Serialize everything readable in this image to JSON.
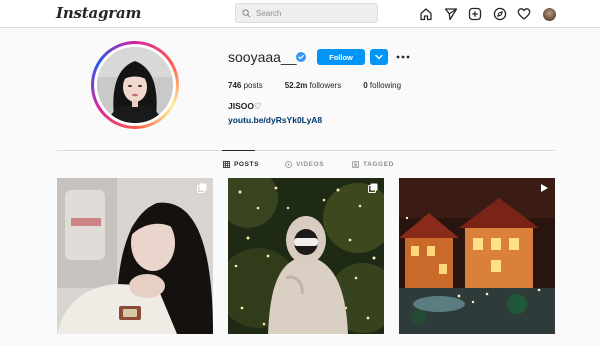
{
  "app": {
    "logo": "Instagram"
  },
  "search": {
    "placeholder": "Search"
  },
  "nav": {
    "icons": [
      "home-icon",
      "direct-message-icon",
      "new-post-icon",
      "explore-icon",
      "activity-heart-icon",
      "profile-avatar"
    ]
  },
  "profile": {
    "username": "sooyaaa__",
    "verified": true,
    "follow_label": "Follow",
    "stats": {
      "posts_count": "746",
      "posts_label": "posts",
      "followers_count": "52.2m",
      "followers_label": "followers",
      "following_count": "0",
      "following_label": "following"
    },
    "full_name": "JISOO♡",
    "link": "youtu.be/dyRsYk0LyA8"
  },
  "tabs": [
    {
      "label": "POSTS",
      "active": true
    },
    {
      "label": "VIDEOS",
      "active": false
    },
    {
      "label": "TAGGED",
      "active": false
    }
  ],
  "posts": [
    {
      "type": "carousel",
      "badge_icon": "carousel-icon"
    },
    {
      "type": "carousel",
      "badge_icon": "carousel-icon"
    },
    {
      "type": "video",
      "badge_icon": "video-play-icon"
    }
  ],
  "colors": {
    "accent": "#0095f6",
    "link": "#00376b",
    "border": "#dbdbdb",
    "background": "#fafafa"
  }
}
